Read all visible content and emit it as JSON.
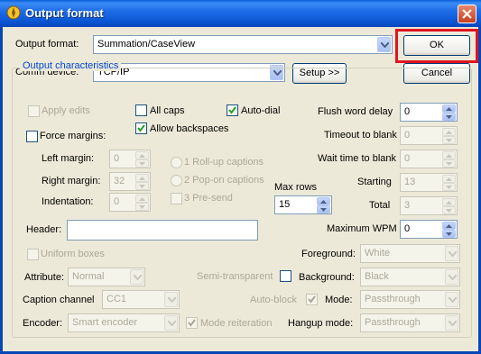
{
  "window": {
    "title": "Output format",
    "colors": {
      "accent": "#0A55D3",
      "highlight": "#E0141E"
    }
  },
  "output_format": {
    "label": "Output format:",
    "value": "Summation/CaseView"
  },
  "comm_device": {
    "label": "Comm device:",
    "value": "TCP/IP"
  },
  "buttons": {
    "setup": "Setup >>",
    "ok": "OK",
    "cancel": "Cancel"
  },
  "group": {
    "label": "Output characteristics"
  },
  "checks": {
    "apply_edits": "Apply edits",
    "all_caps": "All caps",
    "auto_dial": "Auto-dial",
    "allow_backspaces": "Allow backspaces",
    "force_margins": "Force margins:",
    "pre_send": "3 Pre-send",
    "uniform_boxes": "Uniform boxes",
    "semi_transparent": "Semi-transparent",
    "auto_block": "Auto-block",
    "mode_reiteration": "Mode reiteration"
  },
  "radios": {
    "roll_up": "1 Roll-up captions",
    "pop_on": "2 Pop-on captions"
  },
  "margins": {
    "left_label": "Left margin:",
    "left_value": "0",
    "right_label": "Right margin:",
    "right_value": "32",
    "indent_label": "Indentation:",
    "indent_value": "0"
  },
  "max_rows": {
    "label": "Max rows",
    "value": "15"
  },
  "header": {
    "label": "Header:",
    "value": ""
  },
  "right_col": {
    "flush_label": "Flush word delay",
    "flush_value": "0",
    "timeout_label": "Timeout to blank",
    "timeout_value": "0",
    "wait_label": "Wait time to blank",
    "wait_value": "0",
    "starting_label": "Starting",
    "starting_value": "13",
    "total_label": "Total",
    "total_value": "3",
    "max_wpm_label": "Maximum WPM",
    "max_wpm_value": "0"
  },
  "lower": {
    "attribute_label": "Attribute:",
    "attribute_value": "Normal",
    "caption_channel_label": "Caption channel",
    "caption_channel_value": "CC1",
    "encoder_label": "Encoder:",
    "encoder_value": "Smart encoder",
    "foreground_label": "Foreground:",
    "foreground_value": "White",
    "background_label": "Background:",
    "background_value": "Black",
    "mode_label": "Mode:",
    "mode_value": "Passthrough",
    "hangup_label": "Hangup mode:",
    "hangup_value": "Passthrough"
  }
}
